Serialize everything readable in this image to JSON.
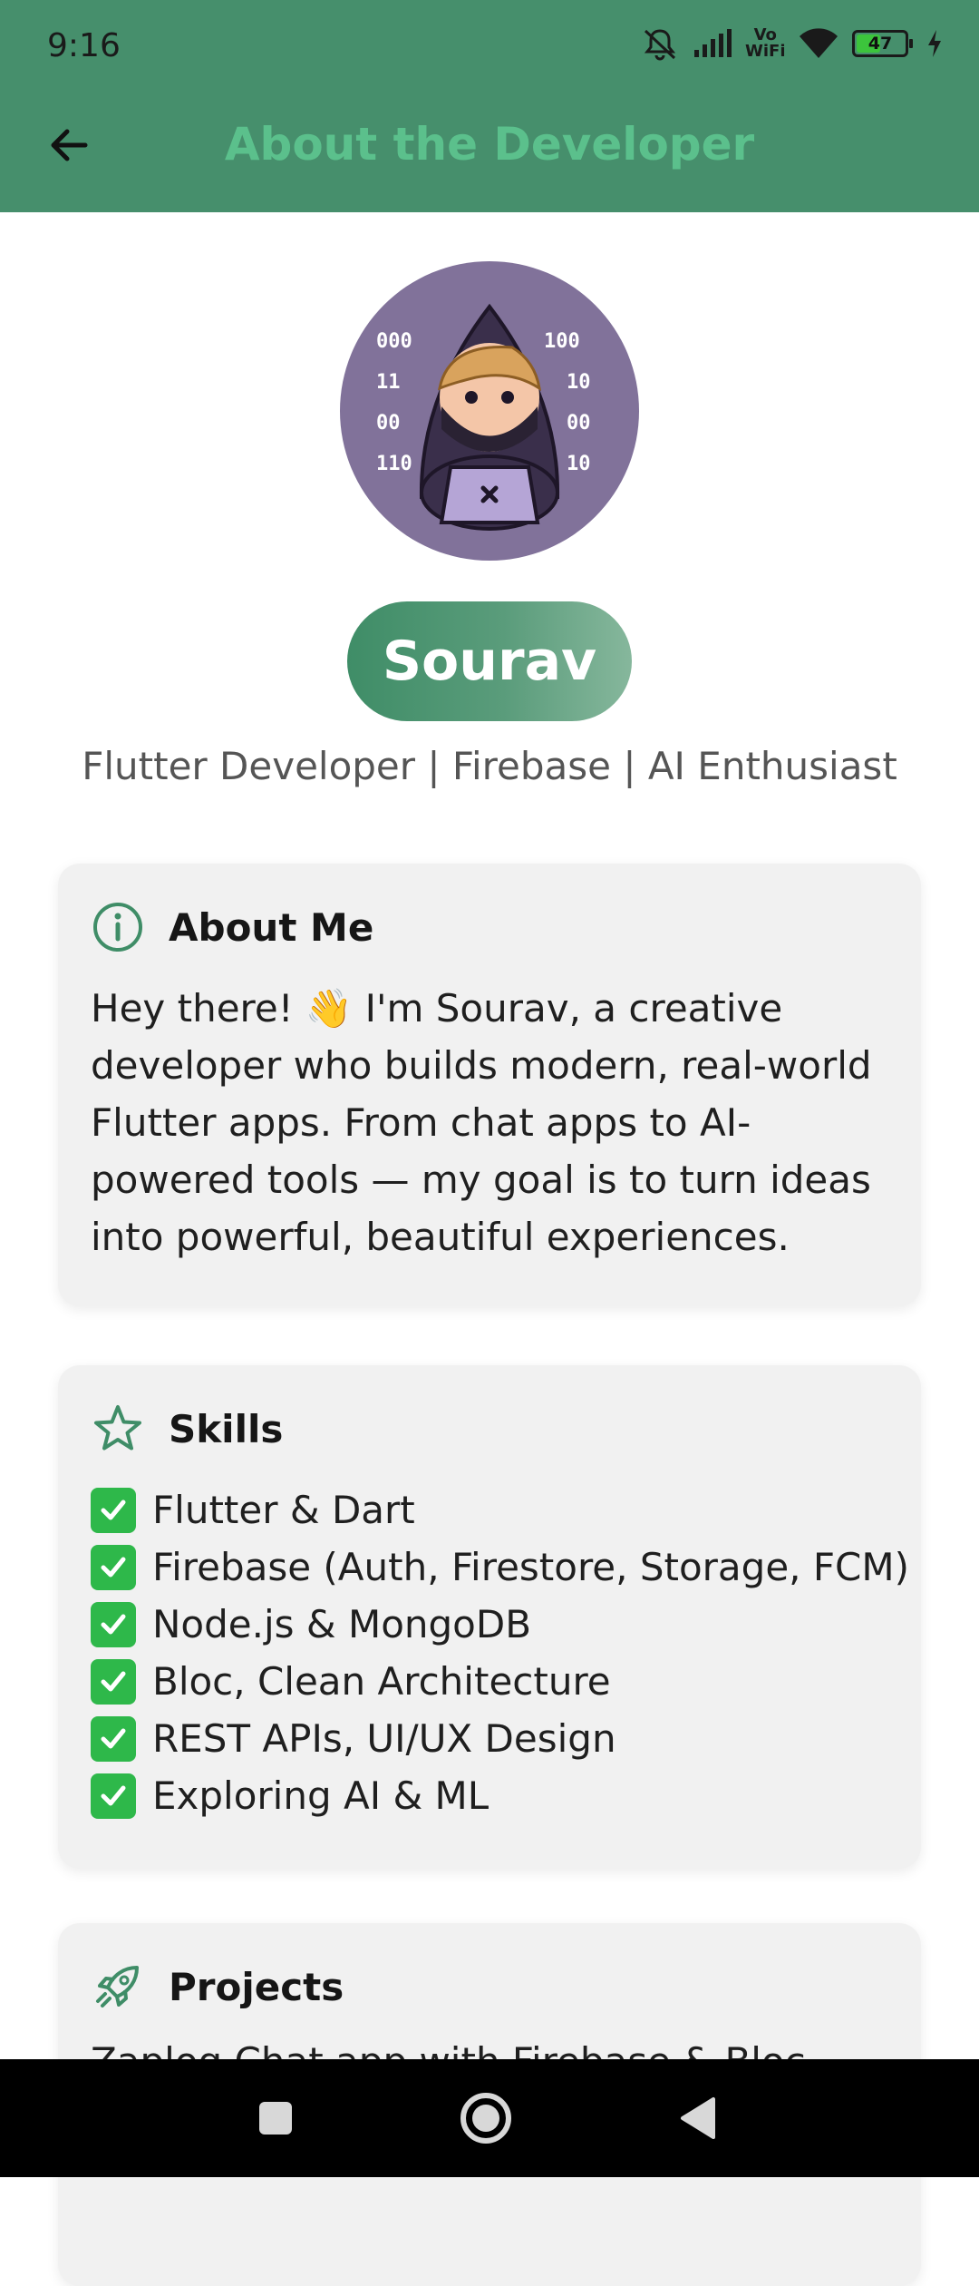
{
  "status_bar": {
    "time": "9:16",
    "vowifi": "Vo WiFi",
    "battery": "47",
    "icons": [
      "muted-bell-icon",
      "signal-icon",
      "vowifi-icon",
      "wifi-icon",
      "battery-icon",
      "charging-icon"
    ]
  },
  "appbar": {
    "title": "About the Developer",
    "back_icon": "arrow-left-icon"
  },
  "profile": {
    "name": "Sourav",
    "tagline": "Flutter Developer | Firebase | AI Enthusiast",
    "avatar_digits": [
      "000",
      "100",
      "11",
      "10",
      "00",
      "00",
      "110",
      "10"
    ]
  },
  "about": {
    "title": "About Me",
    "icon": "info-icon",
    "text": "Hey there! 👋 I'm Sourav, a creative developer who builds modern, real-world Flutter apps. From chat apps to AI-powered tools — my goal is to turn ideas into powerful, beautiful experiences."
  },
  "skills": {
    "title": "Skills",
    "icon": "star-outline-icon",
    "items": [
      "Flutter & Dart",
      "Firebase (Auth, Firestore, Storage, FCM)",
      "Node.js & MongoDB",
      "Bloc, Clean Architecture",
      "REST APIs, UI/UX Design",
      "Exploring AI & ML"
    ]
  },
  "projects": {
    "title": "Projects",
    "icon": "rocket-icon",
    "first_item_peek": "Zaplog Chat app with Firebase & Bloc"
  },
  "nav": {
    "icons": [
      "recents-square-icon",
      "home-circle-icon",
      "back-triangle-icon"
    ]
  },
  "colors": {
    "header": "#468f6c",
    "title": "#5bc08c",
    "accent": "#3f8d67",
    "card": "#f1f1f1",
    "check": "#2eb84a"
  }
}
